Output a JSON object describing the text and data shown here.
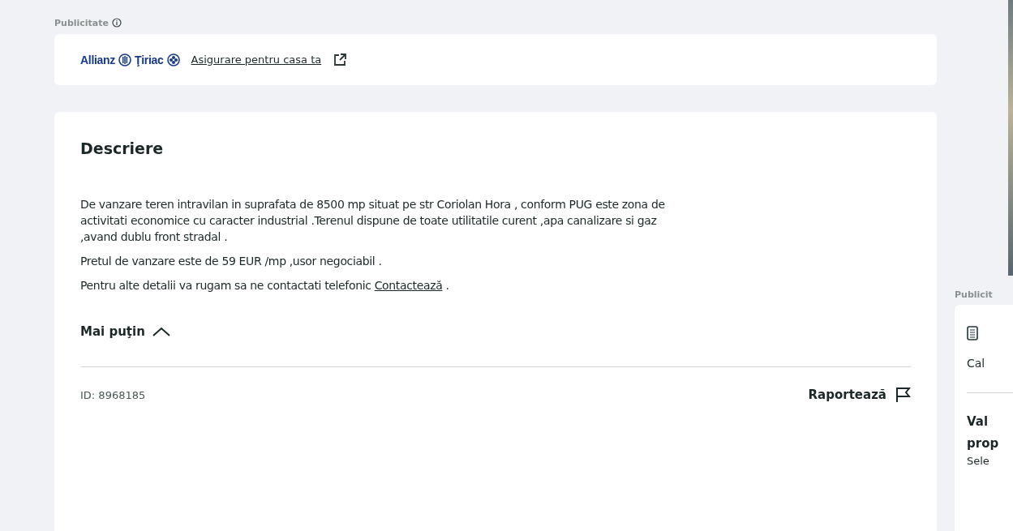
{
  "ad": {
    "label": "Publicitate",
    "brand": "Allianz",
    "brand_2": "Ţiriac",
    "link": "Asigurare pentru casa ta"
  },
  "description": {
    "title": "Descriere",
    "paragraphs": [
      {
        "text": "De vanzare teren intravilan in suprafata de 8500 mp situat pe str Coriolan Hora , conform PUG este zona de activitati economice cu caracter industrial .Terenul dispune de toate utilitatile curent ,apa canalizare si gaz ,avand dublu front stradal ."
      },
      {
        "text": "Pretul de vanzare este de 59 EUR /mp ,usor negociabil ."
      },
      {
        "text": "Pentru alte detalii va rugam sa ne contactati telefonic",
        "link": "Contactează",
        "after": " ."
      }
    ],
    "toggle": {
      "label": "Mai puţin",
      "expanded": true
    },
    "id": "ID: 8968185",
    "report": "Raportează"
  },
  "side": {
    "ad_label": "Publicit",
    "line_1": "Cal",
    "heading_1": "Val",
    "heading_2": "prop",
    "line_2": "Sele"
  }
}
